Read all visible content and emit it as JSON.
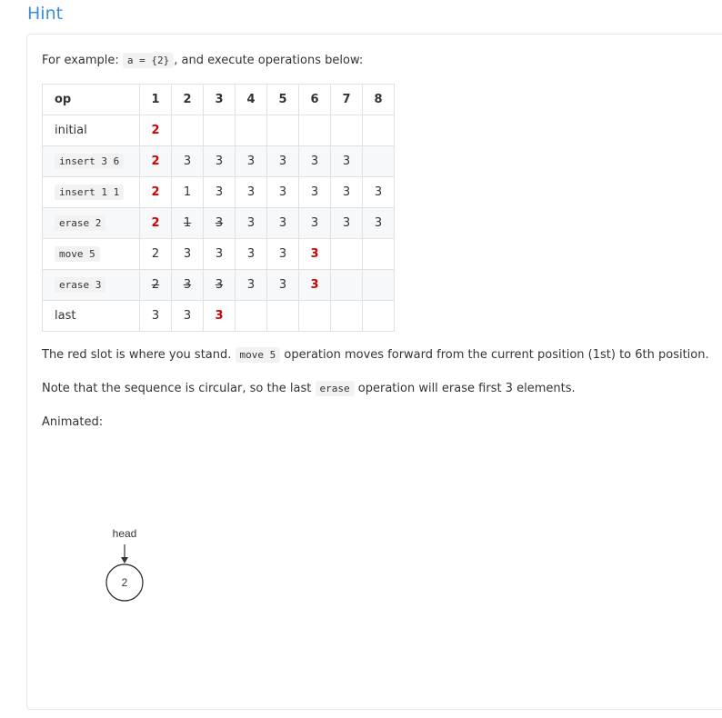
{
  "title": "Hint",
  "intro": {
    "prefix": "For example:",
    "code": "a = {2}",
    "suffix": ", and execute operations below:"
  },
  "table": {
    "op_header": "op",
    "columns": [
      "1",
      "2",
      "3",
      "4",
      "5",
      "6",
      "7",
      "8"
    ],
    "rows": [
      {
        "op": "initial",
        "op_is_code": false,
        "cells": [
          {
            "v": "2",
            "red": true
          },
          {
            "v": ""
          },
          {
            "v": ""
          },
          {
            "v": ""
          },
          {
            "v": ""
          },
          {
            "v": ""
          },
          {
            "v": ""
          },
          {
            "v": ""
          }
        ]
      },
      {
        "op": "insert 3 6",
        "op_is_code": true,
        "cells": [
          {
            "v": "2",
            "red": true
          },
          {
            "v": "3"
          },
          {
            "v": "3"
          },
          {
            "v": "3"
          },
          {
            "v": "3"
          },
          {
            "v": "3"
          },
          {
            "v": "3"
          },
          {
            "v": ""
          }
        ]
      },
      {
        "op": "insert 1 1",
        "op_is_code": true,
        "cells": [
          {
            "v": "2",
            "red": true
          },
          {
            "v": "1"
          },
          {
            "v": "3"
          },
          {
            "v": "3"
          },
          {
            "v": "3"
          },
          {
            "v": "3"
          },
          {
            "v": "3"
          },
          {
            "v": "3"
          }
        ]
      },
      {
        "op": "erase 2",
        "op_is_code": true,
        "cells": [
          {
            "v": "2",
            "red": true
          },
          {
            "v": "1",
            "strike": true
          },
          {
            "v": "3",
            "strike": true
          },
          {
            "v": "3"
          },
          {
            "v": "3"
          },
          {
            "v": "3"
          },
          {
            "v": "3"
          },
          {
            "v": "3"
          }
        ]
      },
      {
        "op": "move 5",
        "op_is_code": true,
        "cells": [
          {
            "v": "2"
          },
          {
            "v": "3"
          },
          {
            "v": "3"
          },
          {
            "v": "3"
          },
          {
            "v": "3"
          },
          {
            "v": "3",
            "red": true
          },
          {
            "v": ""
          },
          {
            "v": ""
          }
        ]
      },
      {
        "op": "erase 3",
        "op_is_code": true,
        "cells": [
          {
            "v": "2",
            "strike": true
          },
          {
            "v": "3",
            "strike": true
          },
          {
            "v": "3",
            "strike": true
          },
          {
            "v": "3"
          },
          {
            "v": "3"
          },
          {
            "v": "3",
            "red": true
          },
          {
            "v": ""
          },
          {
            "v": ""
          }
        ]
      },
      {
        "op": "last",
        "op_is_code": false,
        "cells": [
          {
            "v": "3"
          },
          {
            "v": "3"
          },
          {
            "v": "3",
            "red": true
          },
          {
            "v": ""
          },
          {
            "v": ""
          },
          {
            "v": ""
          },
          {
            "v": ""
          },
          {
            "v": ""
          }
        ]
      }
    ]
  },
  "para1": {
    "prefix": "The red slot is where you stand.",
    "code": "move 5",
    "suffix": "operation moves forward from the current position (1st) to 6th position."
  },
  "para2": {
    "prefix": "Note that the sequence is circular, so the last",
    "code": "erase",
    "suffix": "operation will erase first 3 elements."
  },
  "animated_label": "Animated:",
  "animation": {
    "head_label": "head",
    "node_value": "2"
  },
  "colors": {
    "title": "#3a8fd6",
    "highlight": "#d40000",
    "stripe": "#f6f8fa",
    "border": "#dfe2e5"
  }
}
